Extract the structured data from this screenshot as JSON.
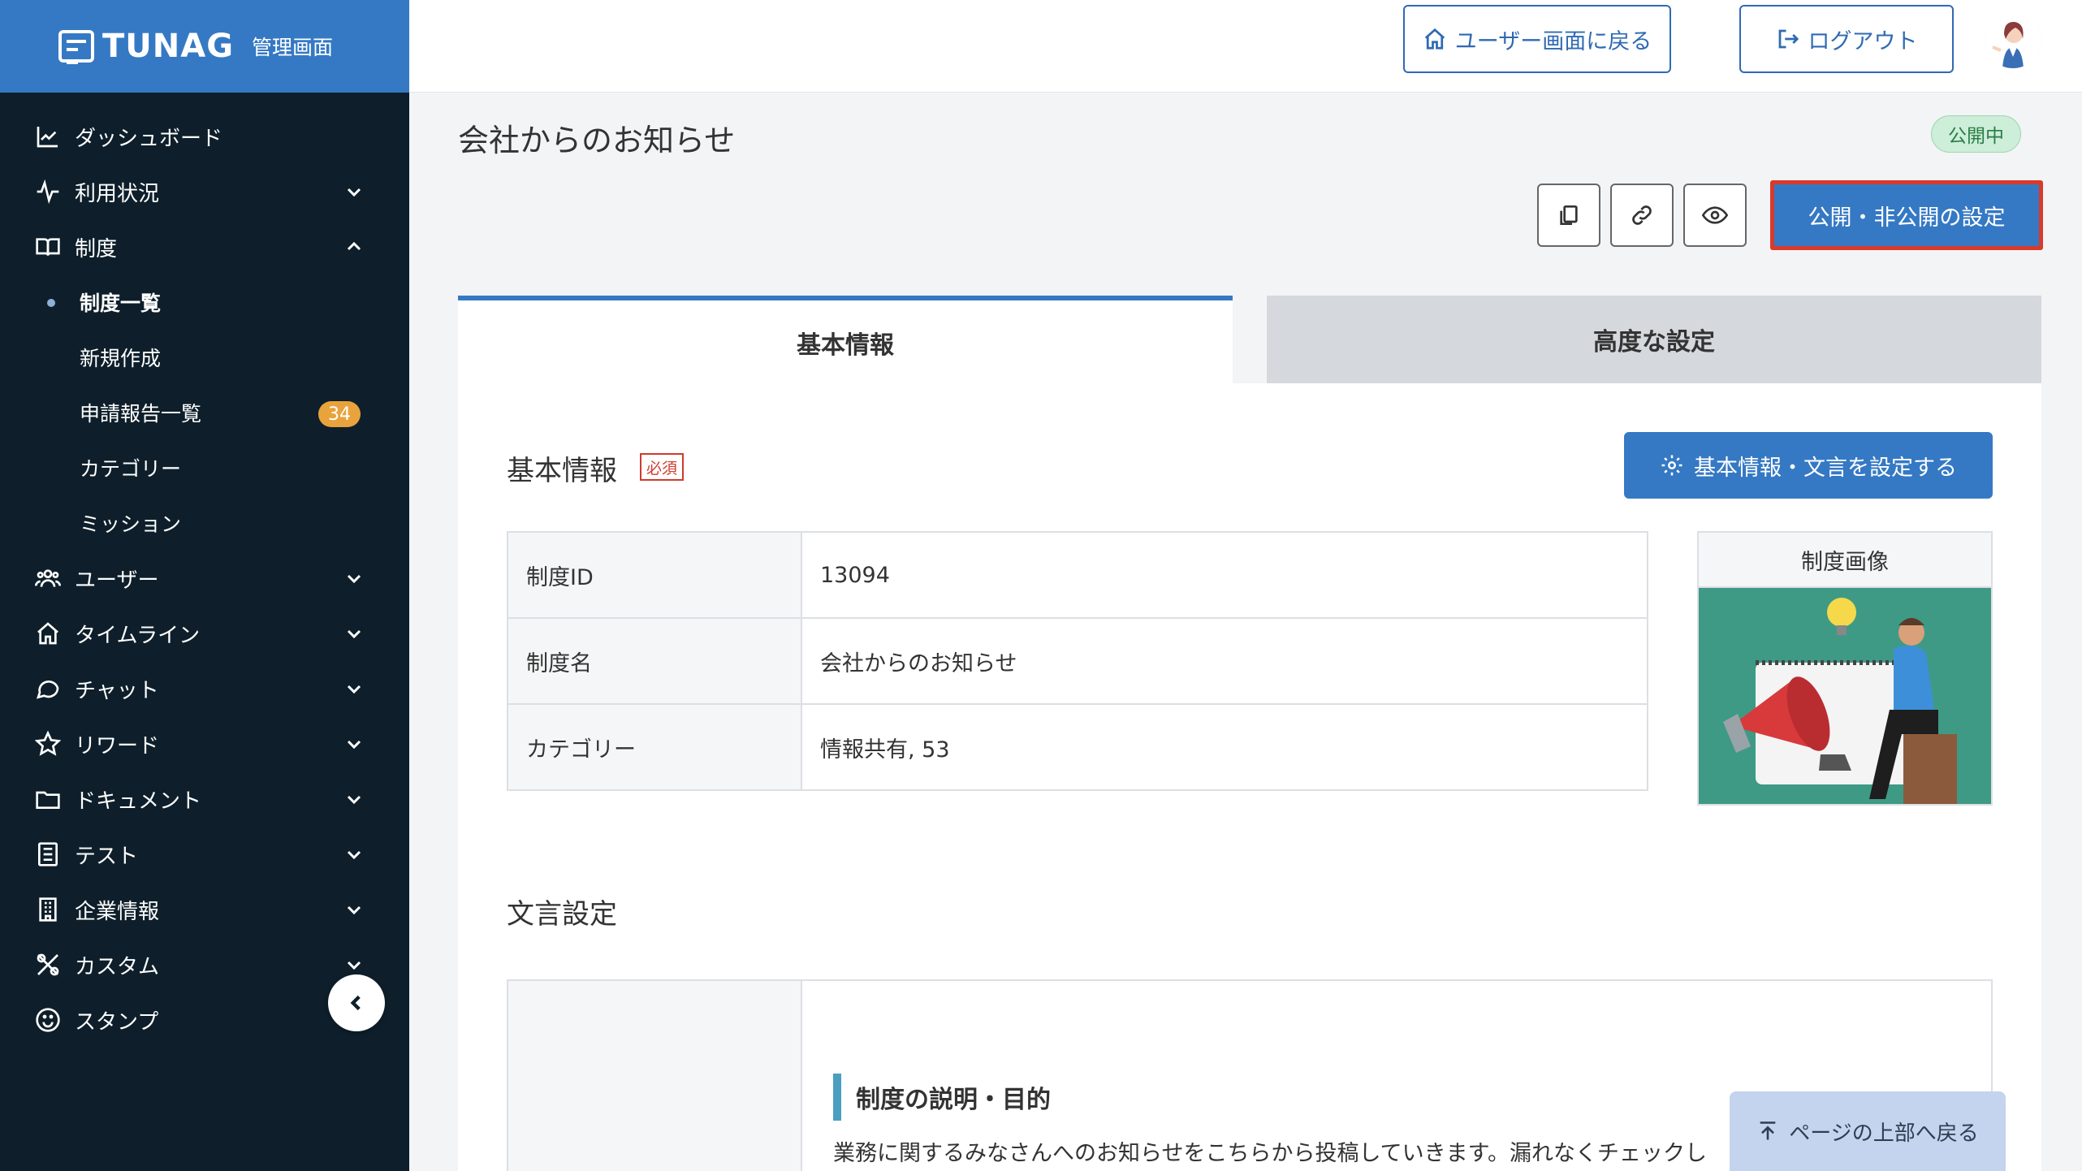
{
  "brand": {
    "logo": "TUNAG",
    "subtitle": "管理画面"
  },
  "sidebar": {
    "items": [
      {
        "label": "ダッシュボード",
        "icon": "chart-line-icon",
        "expandable": false
      },
      {
        "label": "利用状況",
        "icon": "activity-icon",
        "expandable": true
      },
      {
        "label": "制度",
        "icon": "book-icon",
        "expandable": true,
        "expanded": true
      },
      {
        "label": "ユーザー",
        "icon": "users-icon",
        "expandable": true
      },
      {
        "label": "タイムライン",
        "icon": "home-icon",
        "expandable": true
      },
      {
        "label": "チャット",
        "icon": "chat-bubble-icon",
        "expandable": true
      },
      {
        "label": "リワード",
        "icon": "star-icon",
        "expandable": true
      },
      {
        "label": "ドキュメント",
        "icon": "folder-icon",
        "expandable": true
      },
      {
        "label": "テスト",
        "icon": "checklist-icon",
        "expandable": true
      },
      {
        "label": "企業情報",
        "icon": "building-icon",
        "expandable": true
      },
      {
        "label": "カスタム",
        "icon": "tools-icon",
        "expandable": true
      },
      {
        "label": "スタンプ",
        "icon": "smile-icon",
        "expandable": false
      }
    ],
    "sub_items": [
      {
        "label": "制度一覧",
        "active": true
      },
      {
        "label": "新規作成"
      },
      {
        "label": "申請報告一覧",
        "badge": "34"
      },
      {
        "label": "カテゴリー"
      },
      {
        "label": "ミッション"
      }
    ]
  },
  "header": {
    "user_screen_label": "ユーザー画面に戻る",
    "logout_label": "ログアウト"
  },
  "page": {
    "title": "会社からのお知らせ",
    "status": "公開中",
    "publish_button": "公開・非公開の設定"
  },
  "tabs": {
    "basic": "基本情報",
    "advanced": "高度な設定"
  },
  "basic_section": {
    "title": "基本情報",
    "required": "必須",
    "settings_button": "基本情報・文言を設定する",
    "rows": [
      {
        "key": "制度ID",
        "value": "13094"
      },
      {
        "key": "制度名",
        "value": "会社からのお知らせ"
      },
      {
        "key": "カテゴリー",
        "value": "情報共有, 53"
      }
    ],
    "image_caption": "制度画像"
  },
  "text_section": {
    "title": "文言設定",
    "purpose_heading": "制度の説明・目的",
    "purpose_text": "業務に関するみなさんへのお知らせをこちらから投稿していきます。漏れなくチェックし"
  },
  "back_to_top": "ページの上部へ戻る",
  "colors": {
    "brand": "#3579c4",
    "sidebar": "#0e1f2b",
    "highlight": "#d83a2c",
    "status_green": "#cdeed9"
  }
}
